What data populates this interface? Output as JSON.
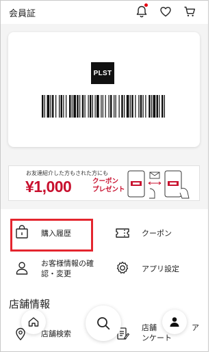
{
  "header": {
    "title": "会員証",
    "icons": [
      "bell-icon",
      "heart-icon",
      "cart-icon"
    ],
    "notification_color": "#e60012"
  },
  "card": {
    "logo_text": "PLST"
  },
  "banner": {
    "small_text": "お友達紹介した方もされた方にも",
    "amount": "¥1,000",
    "coupon_line1": "クーポン",
    "coupon_line2": "プレゼント",
    "accent_color": "#c8102e"
  },
  "menu": {
    "items": [
      {
        "label": "購入履歴",
        "icon": "shopping-bag-icon"
      },
      {
        "label": "クーポン",
        "icon": "ticket-icon"
      },
      {
        "label_line1": "お客様情報の確",
        "label_line2": "認・変更",
        "icon": "person-icon"
      },
      {
        "label": "アプリ設定",
        "icon": "settings-icon"
      }
    ],
    "highlight_color": "#e4252e",
    "section_title": "店舗情報",
    "store_items": [
      {
        "label": "店舗検索",
        "icon": "location-pin-icon"
      },
      {
        "label_line1": "店舗",
        "label_line1_tail": "ア",
        "label_line2": "ンケート",
        "icon": "survey-icon"
      }
    ]
  },
  "bottom_nav": {
    "items": [
      "home-icon",
      "search-icon",
      "account-icon"
    ]
  }
}
